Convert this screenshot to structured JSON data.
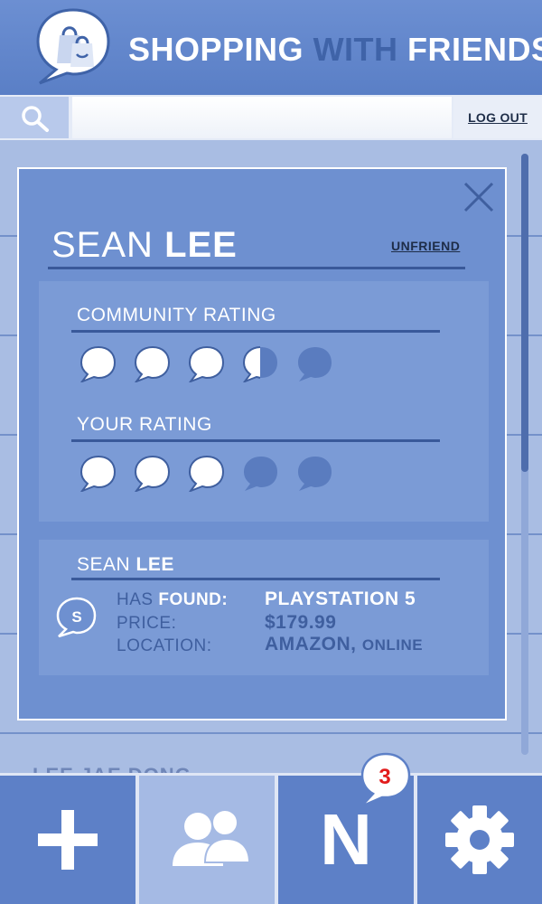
{
  "app": {
    "title_part1": "SHOPPING",
    "title_part2": "WITH",
    "title_part3": "FRIENDS",
    "logo_icon": "shopping-bag-speech-bubble-icon"
  },
  "search": {
    "icon": "search-icon",
    "value": "",
    "placeholder": "",
    "logout_label": "LOG OUT"
  },
  "background_list": {
    "partial_row_name": "LEE JAE DONG"
  },
  "profile": {
    "first_name": "SEAN",
    "last_name": "LEE",
    "unfriend_label": "UNFRIEND",
    "close_icon": "close-icon",
    "community_rating": {
      "label": "COMMUNITY RATING",
      "value": 3.5,
      "max": 5
    },
    "your_rating": {
      "label": "YOUR RATING",
      "value": 3,
      "max": 5
    },
    "found": {
      "first_name": "SEAN",
      "last_name": "LEE",
      "avatar_letter": "S",
      "has_label": "HAS",
      "found_label": "FOUND:",
      "price_label": "PRICE:",
      "location_label": "LOCATION:",
      "item": "PLAYSTATION 5",
      "price": "$179.99",
      "location_store": "AMAZON,",
      "location_type": "ONLINE"
    }
  },
  "nav": {
    "items": [
      {
        "name": "add",
        "icon": "plus-icon"
      },
      {
        "name": "friends",
        "icon": "friends-icon",
        "active": true
      },
      {
        "name": "notifications",
        "label": "N",
        "icon": "notifications-icon"
      },
      {
        "name": "settings",
        "icon": "gear-icon"
      }
    ],
    "notification_count": "3"
  },
  "colors": {
    "header": "#6c8fd2",
    "accent_dark": "#3f63a8",
    "modal_bg": "#6e90d0",
    "panel_bg": "#7b9bd6",
    "badge_number": "#e21b1b"
  }
}
